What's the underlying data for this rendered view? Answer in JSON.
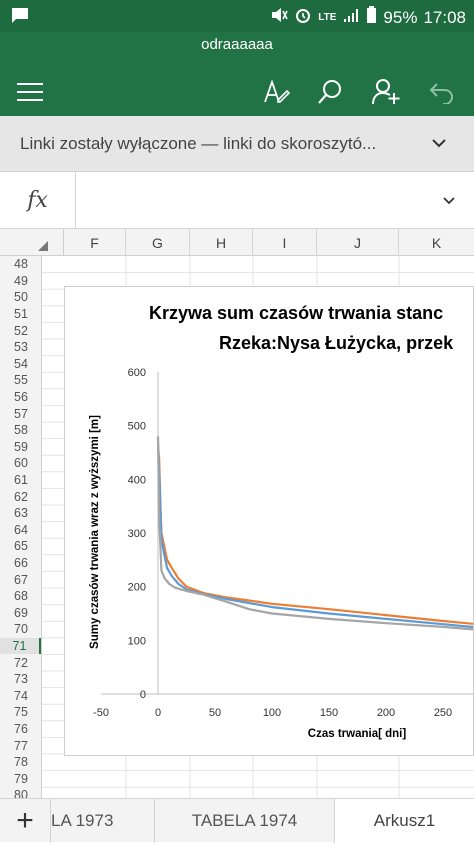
{
  "status_bar": {
    "battery": "95%",
    "time": "17:08",
    "network": "LTE"
  },
  "app": {
    "document_title": "odraaaaaa"
  },
  "notice": {
    "text": "Linki zostały wyłączone — linki do skoroszytó..."
  },
  "formula_bar": {
    "fx_label": "fx",
    "value": ""
  },
  "columns": [
    "F",
    "G",
    "H",
    "I",
    "J",
    "K"
  ],
  "rows": [
    "48",
    "49",
    "50",
    "51",
    "52",
    "53",
    "54",
    "55",
    "56",
    "57",
    "58",
    "59",
    "60",
    "61",
    "62",
    "63",
    "64",
    "65",
    "66",
    "67",
    "68",
    "69",
    "70",
    "71",
    "72",
    "73",
    "74",
    "75",
    "76",
    "77",
    "78",
    "79",
    "80"
  ],
  "selected_row": "71",
  "tabs": {
    "tab1": "LA 1973",
    "tab2": "TABELA 1974",
    "tab3": "Arkusz1",
    "add": "+"
  },
  "chart_data": {
    "type": "line",
    "title_line1": "Krzywa sum czasów trwania stanc",
    "title_line2": "Rzeka:Nysa Łużycka, przek",
    "xlabel": "Czas trwania[ dni]",
    "ylabel": "Sumy czasów trwania wraz z wyższymi [m]",
    "xlim": [
      -50,
      290
    ],
    "ylim": [
      0,
      600
    ],
    "xticks": [
      "-50",
      "0",
      "50",
      "100",
      "150",
      "200",
      "250"
    ],
    "yticks": [
      "0",
      "100",
      "200",
      "300",
      "400",
      "500",
      "600"
    ],
    "grid": false,
    "series": [
      {
        "color": "#ed7d31",
        "x": [
          0,
          1,
          2,
          3,
          5,
          8,
          12,
          18,
          25,
          40,
          60,
          100,
          150,
          200,
          250,
          290
        ],
        "y": [
          460,
          440,
          360,
          300,
          280,
          250,
          235,
          215,
          200,
          188,
          180,
          168,
          158,
          147,
          136,
          128
        ]
      },
      {
        "color": "#5b9bd5",
        "x": [
          0,
          1,
          2,
          3,
          5,
          8,
          12,
          18,
          25,
          40,
          60,
          100,
          150,
          200,
          250,
          290
        ],
        "y": [
          470,
          420,
          350,
          290,
          265,
          235,
          220,
          205,
          195,
          186,
          177,
          162,
          150,
          140,
          130,
          122
        ]
      },
      {
        "color": "#a5a5a5",
        "x": [
          0,
          1,
          2,
          3,
          6,
          10,
          15,
          25,
          40,
          60,
          80,
          100,
          150,
          200,
          250,
          290
        ],
        "y": [
          480,
          330,
          280,
          230,
          215,
          205,
          198,
          192,
          185,
          172,
          158,
          150,
          140,
          132,
          125,
          118
        ]
      }
    ]
  }
}
